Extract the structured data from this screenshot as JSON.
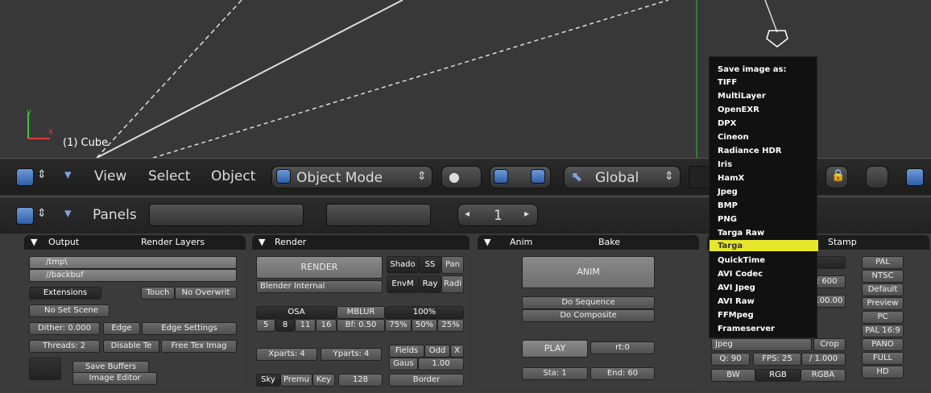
{
  "viewport": {
    "object_label": "(1) Cube",
    "axis_y": "y",
    "axis_x": "x"
  },
  "header3d": {
    "menus": [
      "View",
      "Select",
      "Object"
    ],
    "mode": "Object Mode",
    "transform": "Global"
  },
  "buttons_header": {
    "panels_label": "Panels",
    "frame": "1"
  },
  "output": {
    "tab_output": "Output",
    "tab_layers": "Render Layers",
    "path1": "/tmp\\",
    "path2": "//backbuf",
    "extensions": "Extensions",
    "touch": "Touch",
    "no_overwrite": "No Overwrit",
    "no_set_scene": "No Set Scene",
    "dither": "Dither: 0.000",
    "edge": "Edge",
    "edge_settings": "Edge Settings",
    "threads": "Threads: 2",
    "disable_tex": "Disable Te",
    "free_tex": "Free Tex Imag",
    "save_buffers": "Save Buffers",
    "image_editor": "Image Editor"
  },
  "render": {
    "title": "Render",
    "render_btn": "RENDER",
    "engine": "Blender Internal",
    "shado": "Shado",
    "ss": "SS",
    "pan": "Pan",
    "envm": "EnvM",
    "ray": "Ray",
    "radi": "Radi",
    "osa": "OSA",
    "mblur": "MBLUR",
    "pct100": "100%",
    "osa_vals": [
      "5",
      "8",
      "11",
      "16"
    ],
    "bf": "Bf: 0.50",
    "pct_vals": [
      "75%",
      "50%",
      "25%"
    ],
    "xparts": "Xparts: 4",
    "yparts": "Yparts: 4",
    "fields": "Fields",
    "odd": "Odd",
    "x": "X",
    "gaus": "Gaus",
    "gaus_val": "1.00",
    "sky": "Sky",
    "premu": "Premu",
    "key": "Key",
    "bits": "128",
    "border": "Border"
  },
  "anim": {
    "tab_anim": "Anim",
    "tab_bake": "Bake",
    "anim_btn": "ANIM",
    "do_sequence": "Do Sequence",
    "do_composite": "Do Composite",
    "play": "PLAY",
    "rt": "rt:0",
    "sta": "Sta: 1",
    "end": "End: 60"
  },
  "format": {
    "tab_stamp": "Stamp",
    "sizey": "SizeY: 600",
    "aspy": "AspY: 100.00",
    "format": "Jpeg",
    "crop": "Crop",
    "q": "Q: 90",
    "fps": "FPS: 25",
    "fps_base": "/ 1.000",
    "bw": "BW",
    "rgb": "RGB",
    "rgba": "RGBA",
    "presets": [
      "PAL",
      "NTSC",
      "Default",
      "Preview",
      "PC",
      "PAL 16:9",
      "PANO",
      "FULL",
      "HD"
    ]
  },
  "dropdown": {
    "title": "Save image as:",
    "items": [
      "TIFF",
      "MultiLayer",
      "OpenEXR",
      "DPX",
      "Cineon",
      "Radiance HDR",
      "Iris",
      "HamX",
      "Jpeg",
      "BMP",
      "PNG",
      "Targa Raw",
      "Targa",
      "QuickTime",
      "AVI Codec",
      "AVI Jpeg",
      "AVI Raw",
      "FFMpeg",
      "Frameserver"
    ],
    "highlighted": "Targa",
    "highlight_color": "#e6e62c"
  }
}
